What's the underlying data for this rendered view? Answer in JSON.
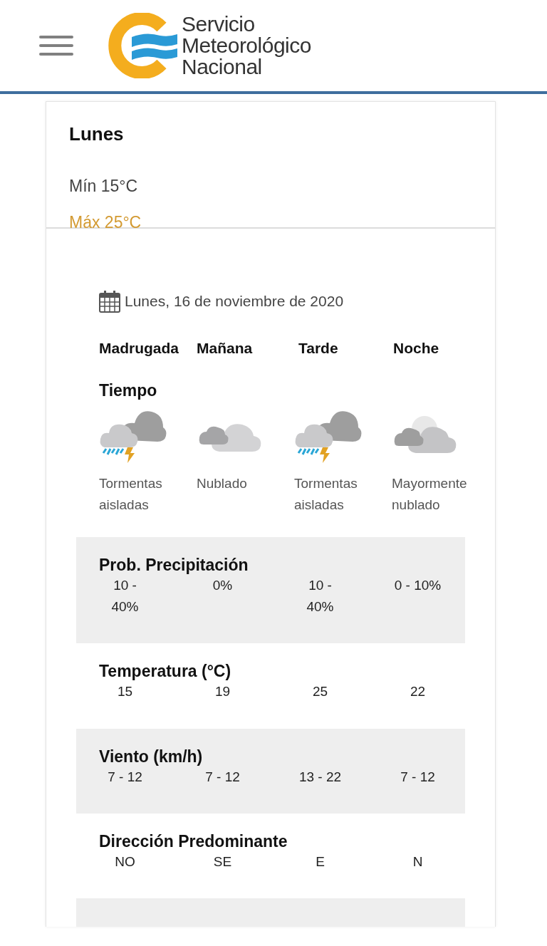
{
  "header": {
    "logo_lines": [
      "Servicio",
      "Meteorológico",
      "Nacional"
    ]
  },
  "summary": {
    "day": "Lunes",
    "min": "Mín 15°C",
    "max": "Máx 25°C"
  },
  "forecast": {
    "date": "Lunes, 16 de noviembre de 2020",
    "periods": [
      "Madrugada",
      "Mañana",
      "Tarde",
      "Noche"
    ],
    "weather_title": "Tiempo",
    "weather": [
      {
        "kind": "storm",
        "label": "Tormentas aisladas"
      },
      {
        "kind": "cloudy",
        "label": "Nublado"
      },
      {
        "kind": "storm",
        "label": "Tormentas aisladas"
      },
      {
        "kind": "night_cloudy",
        "label": "Mayormente nublado"
      }
    ],
    "rows": [
      {
        "title": "Prob. Precipitación",
        "values": [
          "10 - 40%",
          "0%",
          "10 - 40%",
          "0 - 10%"
        ]
      },
      {
        "title": "Temperatura (°C)",
        "values": [
          "15",
          "19",
          "25",
          "22"
        ]
      },
      {
        "title": "Viento (km/h)",
        "values": [
          "7 - 12",
          "7 - 12",
          "13 - 22",
          "7 - 12"
        ]
      },
      {
        "title": "Dirección Predominante",
        "values": [
          "NO",
          "SE",
          "E",
          "N"
        ]
      }
    ]
  }
}
